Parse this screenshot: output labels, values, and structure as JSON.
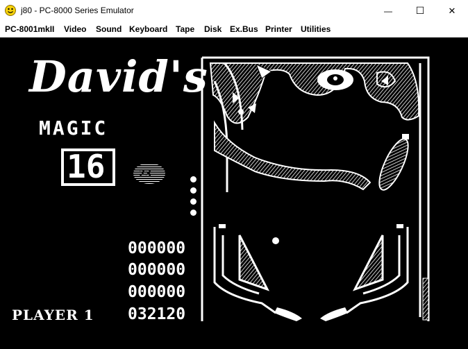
{
  "window": {
    "title": "j80 - PC-8000 Series Emulator",
    "minimize_glyph": "—",
    "maximize_glyph": "☐",
    "close_glyph": "✕"
  },
  "menu": {
    "items": [
      "PC-8001mkII",
      "Video",
      "Sound",
      "Keyboard",
      "Tape",
      "Disk",
      "Ex.Bus",
      "Printer",
      "Utilities"
    ]
  },
  "game": {
    "logo": "David's",
    "magic_label": "MAGIC",
    "magic_value": "16",
    "ball_token": "23",
    "scores": [
      "000000",
      "000000",
      "000000",
      "032120"
    ],
    "player_label": "PLAYER 1",
    "balls_remaining": 4
  },
  "colors": {
    "screen_bg": "#000000",
    "pixel_fg": "#ffffff",
    "icon_yellow": "#f5d10a"
  }
}
